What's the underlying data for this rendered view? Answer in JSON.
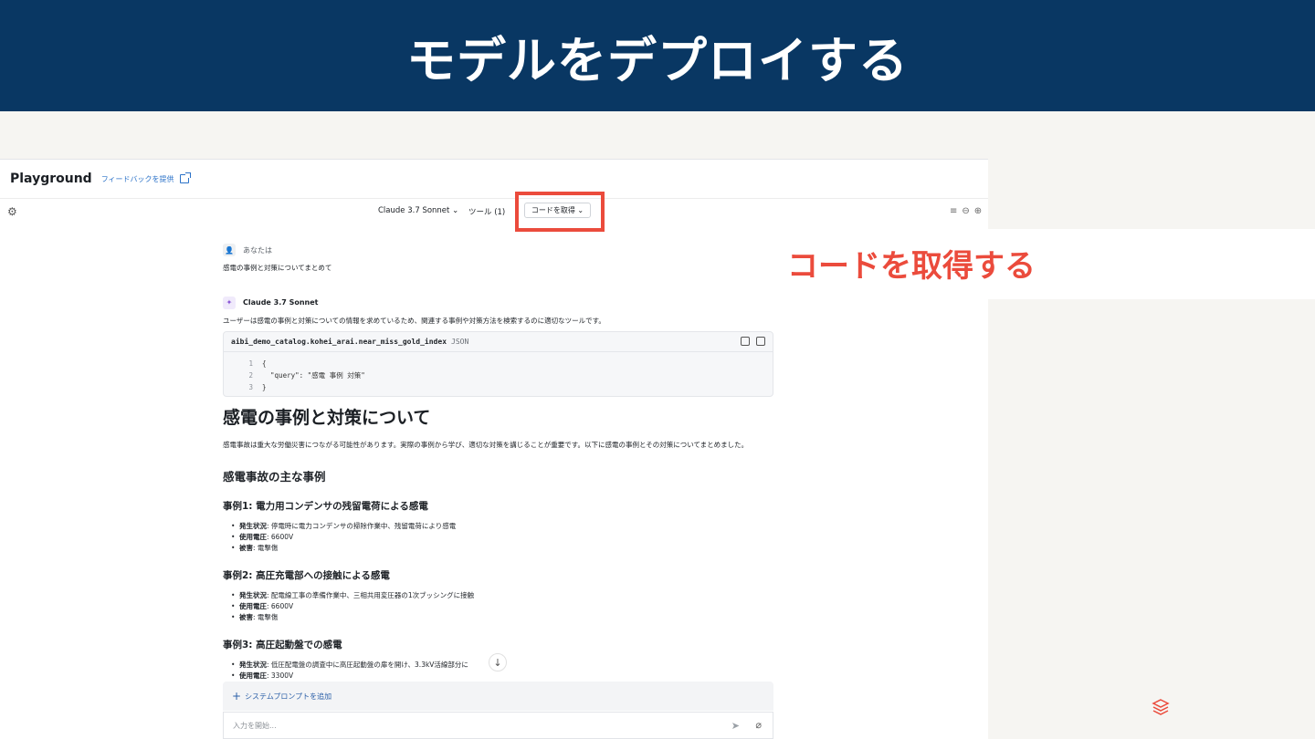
{
  "banner": {
    "title": "モデルをデプロイする"
  },
  "playground": {
    "title": "Playground",
    "feedback_link": "フィードバックを提供"
  },
  "toolbar": {
    "model": "Claude 3.7 Sonnet",
    "tools": "ツール (1)",
    "get_code": "コードを取得"
  },
  "chat": {
    "user_label": "あなたは",
    "user_message": "感電の事例と対策についてまとめて",
    "ai_label": "Claude 3.7 Sonnet",
    "ai_intro": "ユーザーは感電の事例と対策についての情報を求めているため、関連する事例や対策方法を検索するのに適切なツールです。",
    "code_block": {
      "name": "aibi_demo_catalog.kohei_arai.near_miss_gold_index",
      "lang": "JSON",
      "lines": [
        {
          "n": "1",
          "text": "{"
        },
        {
          "n": "2",
          "text": "  \"query\": \"感電 事例 対策\""
        },
        {
          "n": "3",
          "text": "}"
        }
      ]
    },
    "h1": "感電の事例と対策について",
    "para": "感電事故は重大な労働災害につながる可能性があります。実際の事例から学び、適切な対策を講じることが重要です。以下に感電の事例とその対策についてまとめました。",
    "h2": "感電事故の主な事例",
    "cases": [
      {
        "title": "事例1: 電力用コンデンサの残留電荷による感電",
        "items": [
          {
            "k": "発生状況",
            "v": ": 停電時に電力コンデンサの掃除作業中、残留電荷により感電"
          },
          {
            "k": "使用電圧",
            "v": ": 6600V"
          },
          {
            "k": "被害",
            "v": ": 電撃傷"
          }
        ]
      },
      {
        "title": "事例2: 高圧充電部への接触による感電",
        "items": [
          {
            "k": "発生状況",
            "v": ": 配電線工事の準備作業中、三相共用変圧器の1次ブッシングに接触"
          },
          {
            "k": "使用電圧",
            "v": ": 6600V"
          },
          {
            "k": "被害",
            "v": ": 電撃傷"
          }
        ]
      },
      {
        "title": "事例3: 高圧起動盤での感電",
        "items": [
          {
            "k": "発生状況",
            "v": ": 低圧配電盤の調査中に高圧起動盤の扉を開け、3.3kV活線部分に"
          },
          {
            "k": "使用電圧",
            "v": ": 3300V"
          }
        ]
      }
    ],
    "add_system_prompt": "システムプロンプトを追加",
    "input_placeholder": "入力を開始..."
  },
  "callout": {
    "text": "コードを取得する"
  },
  "colors": {
    "banner": "#093763",
    "accent_red": "#eb4b3c",
    "link": "#2b72c8"
  },
  "icons": [
    "settings-icon",
    "external-link-icon",
    "user-icon",
    "sparkle-icon",
    "terminal-icon",
    "copy-icon",
    "arrow-down-icon",
    "send-icon",
    "attach-icon",
    "databricks-logo"
  ]
}
